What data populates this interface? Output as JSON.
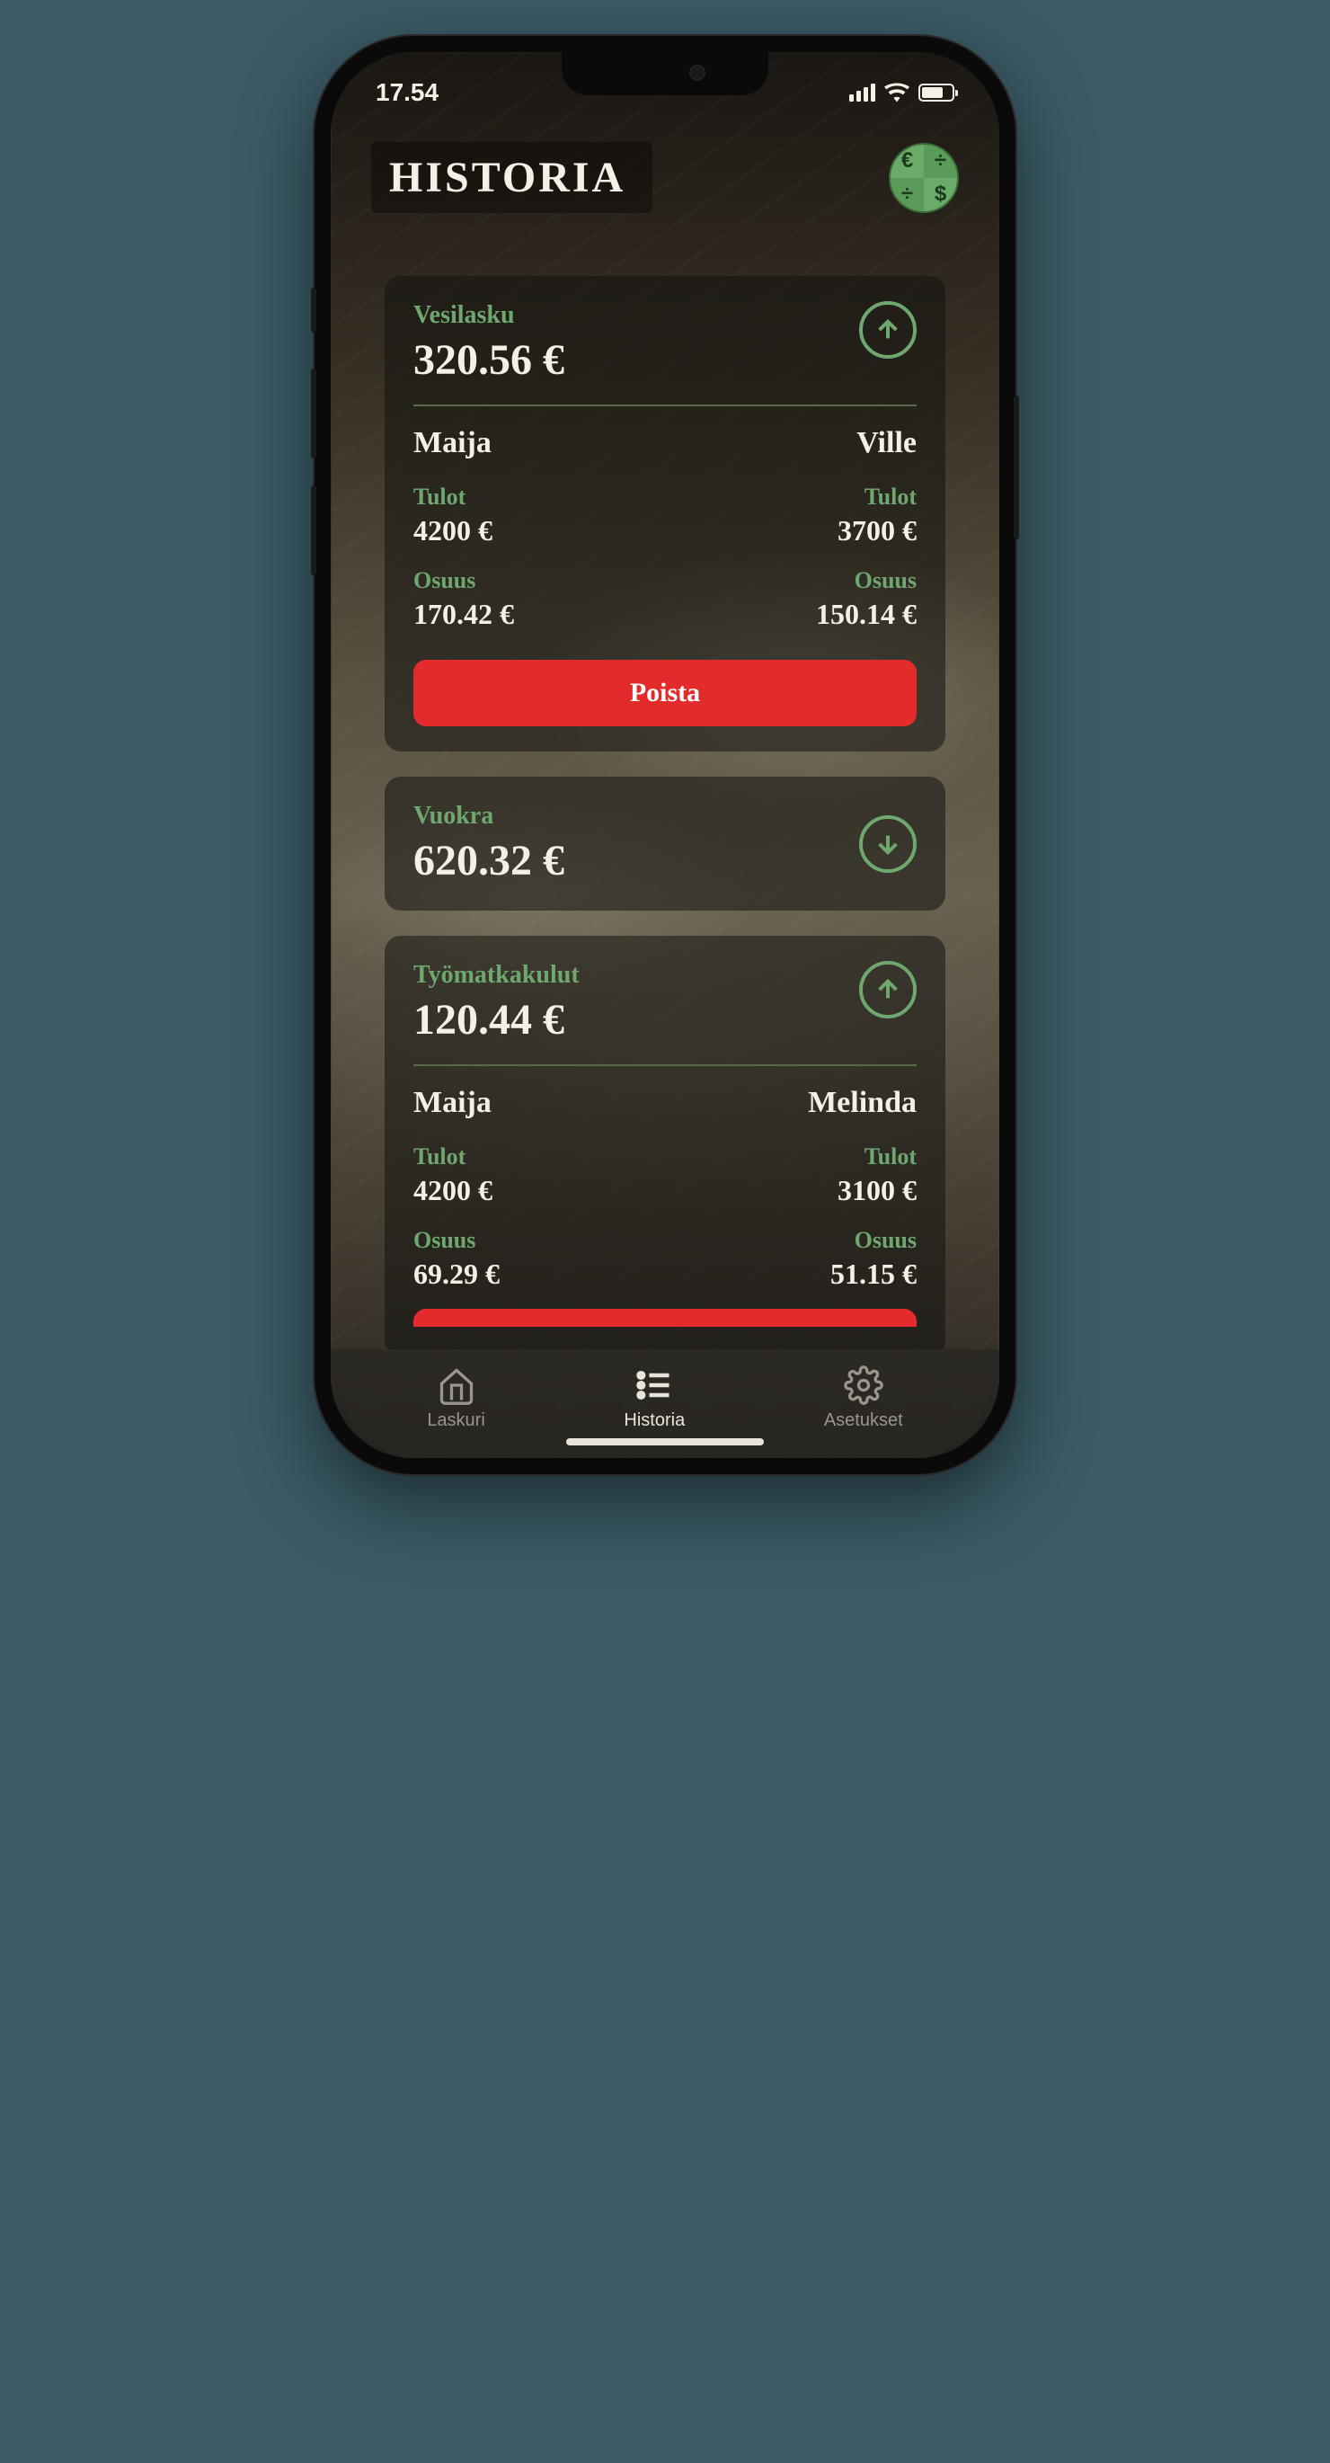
{
  "status": {
    "time": "17.54"
  },
  "header": {
    "title": "HISTORIA"
  },
  "labels": {
    "income": "Tulot",
    "share": "Osuus",
    "delete": "Poista"
  },
  "cards": [
    {
      "title": "Vesilasku",
      "amount": "320.56 €",
      "expanded": true,
      "arrow": "up",
      "left": {
        "name": "Maija",
        "income": "4200 €",
        "share": "170.42 €"
      },
      "right": {
        "name": "Ville",
        "income": "3700 €",
        "share": "150.14 €"
      }
    },
    {
      "title": "Vuokra",
      "amount": "620.32 €",
      "expanded": false,
      "arrow": "down"
    },
    {
      "title": "Työmatkakulut",
      "amount": "120.44 €",
      "expanded": true,
      "arrow": "up",
      "left": {
        "name": "Maija",
        "income": "4200 €",
        "share": "69.29 €"
      },
      "right": {
        "name": "Melinda",
        "income": "3100 €",
        "share": "51.15 €"
      }
    }
  ],
  "tabs": {
    "calculator": "Laskuri",
    "history": "Historia",
    "settings": "Asetukset"
  }
}
